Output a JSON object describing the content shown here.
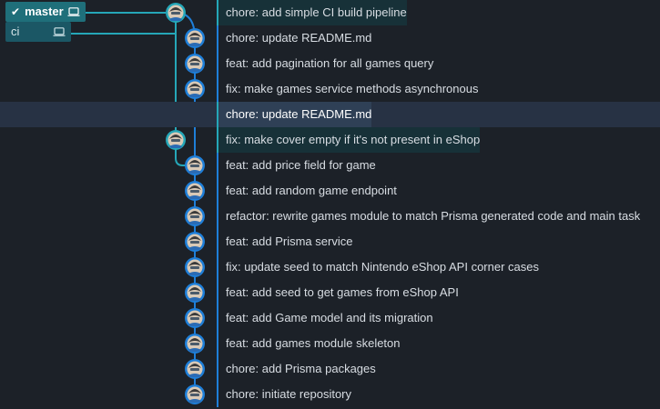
{
  "branches": {
    "master": {
      "label": "master",
      "icon": "laptop-icon",
      "checked": true
    },
    "ci": {
      "label": "ci",
      "icon": "laptop-icon"
    }
  },
  "colors": {
    "teal": "#25a7b8",
    "blue": "#1e7fd9"
  },
  "commits": [
    {
      "message": "chore: add simple CI build pipeline",
      "lane": "teal"
    },
    {
      "message": "chore: update README.md",
      "lane": "blue"
    },
    {
      "message": "feat: add pagination for all games query",
      "lane": "blue"
    },
    {
      "message": "fix: make games service methods asynchronous",
      "lane": "blue"
    },
    {
      "message": "chore: update README.md",
      "lane": "teal",
      "selected": true
    },
    {
      "message": "fix: make cover empty if it's not present in eShop",
      "lane": "teal"
    },
    {
      "message": "feat: add price field for game",
      "lane": "blue"
    },
    {
      "message": "feat: add random game endpoint",
      "lane": "blue"
    },
    {
      "message": "refactor: rewrite games module to match Prisma generated code and main task",
      "lane": "blue"
    },
    {
      "message": "feat: add Prisma service",
      "lane": "blue"
    },
    {
      "message": "fix: update seed to match Nintendo eShop API corner cases",
      "lane": "blue"
    },
    {
      "message": "feat: add seed to get games from eShop API",
      "lane": "blue"
    },
    {
      "message": "feat: add Game model and its migration",
      "lane": "blue"
    },
    {
      "message": "feat: add games module skeleton",
      "lane": "blue"
    },
    {
      "message": "chore: add Prisma packages",
      "lane": "blue"
    },
    {
      "message": "chore: initiate repository",
      "lane": "blue"
    }
  ]
}
